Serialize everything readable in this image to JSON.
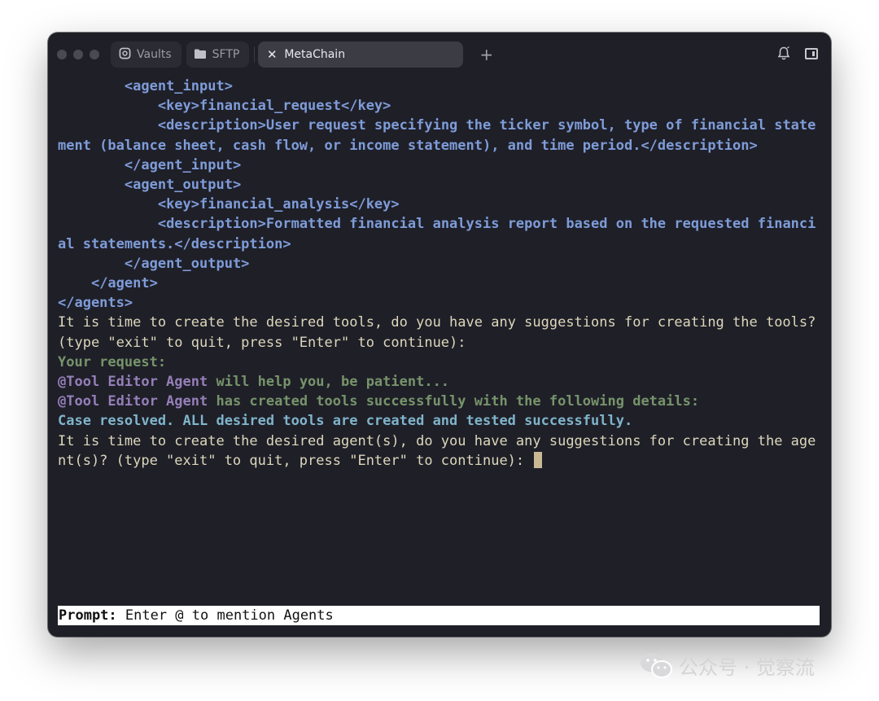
{
  "window": {
    "tabs": [
      {
        "label": "Vaults",
        "icon": "vault-icon"
      },
      {
        "label": "SFTP",
        "icon": "folder-icon"
      },
      {
        "label": "MetaChain",
        "icon": "close-icon",
        "active": true
      }
    ],
    "new_tab_glyph": "+",
    "right_icons": [
      "bell-icon",
      "sidebar-panel-icon"
    ]
  },
  "terminal": {
    "lines": [
      {
        "segments": [
          {
            "style": "xml",
            "text": "        <agent_input>"
          }
        ]
      },
      {
        "segments": [
          {
            "style": "xml",
            "text": "            <key>financial_request</key>"
          }
        ]
      },
      {
        "segments": [
          {
            "style": "xml",
            "text": "            <description>User request specifying the ticker symbol, type of financial statement (balance sheet, cash flow, or income statement), and time period.</description>"
          }
        ]
      },
      {
        "segments": [
          {
            "style": "xml",
            "text": "        </agent_input>"
          }
        ]
      },
      {
        "segments": [
          {
            "style": "xml",
            "text": "        <agent_output>"
          }
        ]
      },
      {
        "segments": [
          {
            "style": "xml",
            "text": "            <key>financial_analysis</key>"
          }
        ]
      },
      {
        "segments": [
          {
            "style": "xml",
            "text": "            <description>Formatted financial analysis report based on the requested financial statements.</description>"
          }
        ]
      },
      {
        "segments": [
          {
            "style": "xml",
            "text": "        </agent_output>"
          }
        ]
      },
      {
        "segments": [
          {
            "style": "xml",
            "text": "    </agent>"
          }
        ]
      },
      {
        "segments": [
          {
            "style": "xml",
            "text": "</agents>"
          }
        ]
      },
      {
        "segments": [
          {
            "style": "plain",
            "text": "It is time to create the desired tools, do you have any suggestions for creating the tools? (type \"exit\" to quit, press \"Enter\" to continue):"
          }
        ]
      },
      {
        "segments": [
          {
            "style": "green",
            "text": "Your request:"
          }
        ]
      },
      {
        "segments": [
          {
            "style": "purple",
            "text": "@Tool Editor Agent"
          },
          {
            "style": "green",
            "text": " will help you, be patient..."
          }
        ]
      },
      {
        "segments": [
          {
            "style": "purple",
            "text": "@Tool Editor Agent"
          },
          {
            "style": "green",
            "text": " has created tools successfully with the following details:"
          }
        ]
      },
      {
        "segments": [
          {
            "style": "blue-bold",
            "text": "Case resolved. ALL desired tools are created and tested successfully."
          }
        ]
      },
      {
        "segments": [
          {
            "style": "plain",
            "text": "It is time to create the desired agent(s), do you have any suggestions for creating the agent(s)? (type \"exit\" to quit, press \"Enter\" to continue): "
          }
        ],
        "cursor": true
      }
    ]
  },
  "prompt": {
    "label": "Prompt:",
    "placeholder": " Enter @ to mention Agents"
  },
  "watermark": {
    "text": "公众号 · 觉察流"
  },
  "colors": {
    "background": "#1f1f28",
    "xml": "#7e9cd8",
    "green": "#76946a",
    "purple": "#957fb8",
    "blue_bold": "#7fb4ca",
    "plain": "#dcd7ba",
    "cursor": "#c8b994"
  }
}
